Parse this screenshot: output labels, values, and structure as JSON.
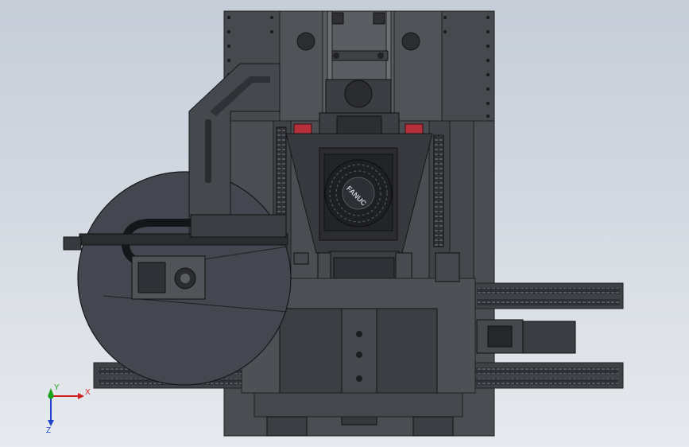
{
  "viewport": {
    "background_top": "#c5cdd8",
    "background_bottom": "#e7eaee",
    "model_body_color": "#4a4d52",
    "model_dark_color": "#3a3d42",
    "model_edge_color": "#1e1f22",
    "accent_red": "#b5303a"
  },
  "fan": {
    "brand_text": "FANUC"
  },
  "triad": {
    "x_label": "X",
    "y_label": "Y",
    "z_label": "Z",
    "x_color": "#d21f1f",
    "y_color": "#1aa31a",
    "z_color": "#2244cc"
  }
}
